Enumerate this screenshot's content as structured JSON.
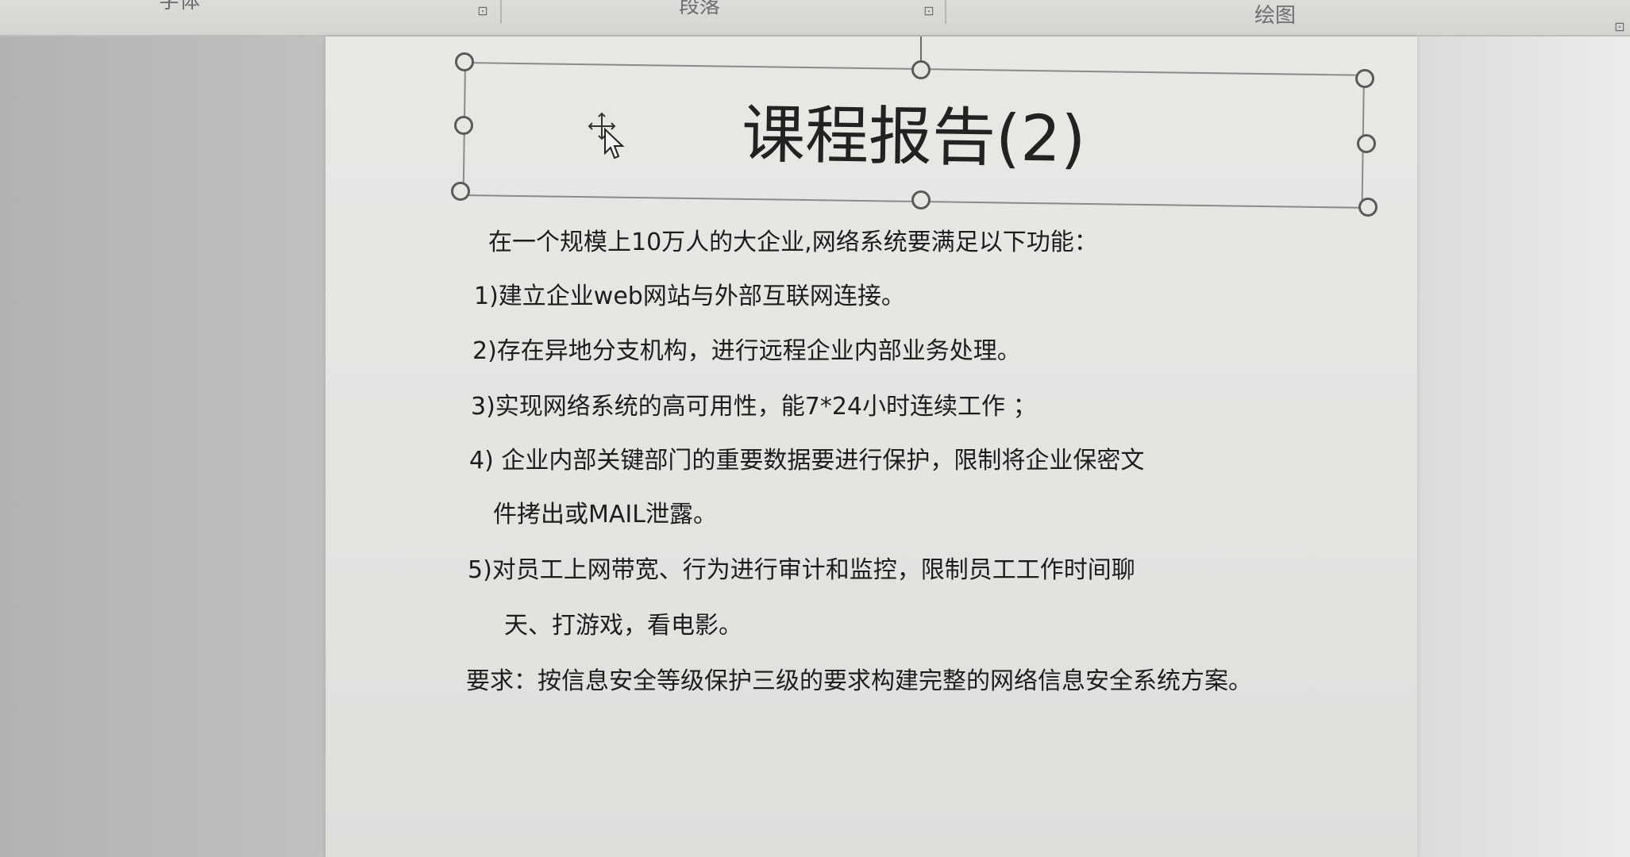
{
  "ribbon": {
    "group_font": "字体",
    "group_paragraph": "段落",
    "group_drawing": "绘图",
    "launcher_glyph": "⊡"
  },
  "slide": {
    "title": "课程报告(2)",
    "body": {
      "intro": "在一个规模上10万人的大企业,网络系统要满足以下功能：",
      "item1": "1)建立企业web网站与外部互联网连接。",
      "item2": "2)存在异地分支机构，进行远程企业内部业务处理。",
      "item3": "3)实现网络系统的高可用性，能7*24小时连续工作 ；",
      "item4_line1": "4) 企业内部关键部门的重要数据要进行保护，限制将企业保密文",
      "item4_line2": "件拷出或MAIL泄露。",
      "item5_line1": "5)对员工上网带宽、行为进行审计和监控，限制员工工作时间聊",
      "item5_line2": "天、打游戏，看电影。",
      "requirement": "要求：按信息安全等级保护三级的要求构建完整的网络信息安全系统方案。"
    }
  },
  "cursor": {
    "icon": "move-cursor-icon"
  },
  "colors": {
    "slide_bg": "#e6e6e3",
    "workspace_bg": "#c4c4c2",
    "text": "#1d1d1d"
  }
}
